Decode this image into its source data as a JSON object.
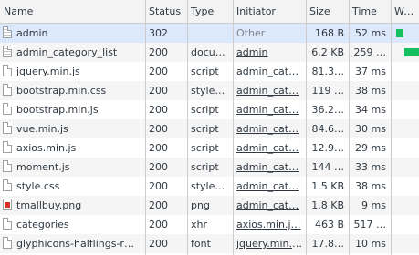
{
  "columns": {
    "name": "Name",
    "status": "Status",
    "type": "Type",
    "initiator": "Initiator",
    "size": "Size",
    "time": "Time",
    "waterfall": "Waterfall"
  },
  "colors": {
    "selected_row": "#dce8fb",
    "waterfall_bar": "#16c060"
  },
  "requests": [
    {
      "name": "admin",
      "status": "302",
      "type": "",
      "initiator": "Other",
      "initiator_link": false,
      "size": "168 B",
      "time": "52 ms",
      "icon": "document-icon"
    },
    {
      "name": "admin_category_list",
      "status": "200",
      "type": "docu…",
      "initiator": "admin",
      "initiator_link": true,
      "size": "6.2 KB",
      "time": "259 …",
      "icon": "document-icon"
    },
    {
      "name": "jquery.min.js",
      "status": "200",
      "type": "script",
      "initiator": "admin_cat…",
      "initiator_link": true,
      "size": "81.3…",
      "time": "37 ms",
      "icon": "file-icon"
    },
    {
      "name": "bootstrap.min.css",
      "status": "200",
      "type": "style…",
      "initiator": "admin_cat…",
      "initiator_link": true,
      "size": "119 …",
      "time": "38 ms",
      "icon": "file-icon"
    },
    {
      "name": "bootstrap.min.js",
      "status": "200",
      "type": "script",
      "initiator": "admin_cat…",
      "initiator_link": true,
      "size": "36.2…",
      "time": "34 ms",
      "icon": "file-icon"
    },
    {
      "name": "vue.min.js",
      "status": "200",
      "type": "script",
      "initiator": "admin_cat…",
      "initiator_link": true,
      "size": "84.6…",
      "time": "30 ms",
      "icon": "file-icon"
    },
    {
      "name": "axios.min.js",
      "status": "200",
      "type": "script",
      "initiator": "admin_cat…",
      "initiator_link": true,
      "size": "12.9…",
      "time": "29 ms",
      "icon": "file-icon"
    },
    {
      "name": "moment.js",
      "status": "200",
      "type": "script",
      "initiator": "admin_cat…",
      "initiator_link": true,
      "size": "144 …",
      "time": "33 ms",
      "icon": "file-icon"
    },
    {
      "name": "style.css",
      "status": "200",
      "type": "style…",
      "initiator": "admin_cat…",
      "initiator_link": true,
      "size": "1.5 KB",
      "time": "38 ms",
      "icon": "file-icon"
    },
    {
      "name": "tmallbuy.png",
      "status": "200",
      "type": "png",
      "initiator": "admin_cat…",
      "initiator_link": true,
      "size": "1.8 KB",
      "time": "9 ms",
      "icon": "image-icon"
    },
    {
      "name": "categories",
      "status": "200",
      "type": "xhr",
      "initiator": "axios.min.j…",
      "initiator_link": true,
      "size": "463 B",
      "time": "517 …",
      "icon": "file-icon"
    },
    {
      "name": "glyphicons-halflings-r…",
      "status": "200",
      "type": "font",
      "initiator": "jquery.min.j…",
      "initiator_link": true,
      "size": "17.8…",
      "time": "10 ms",
      "icon": "file-icon"
    }
  ]
}
